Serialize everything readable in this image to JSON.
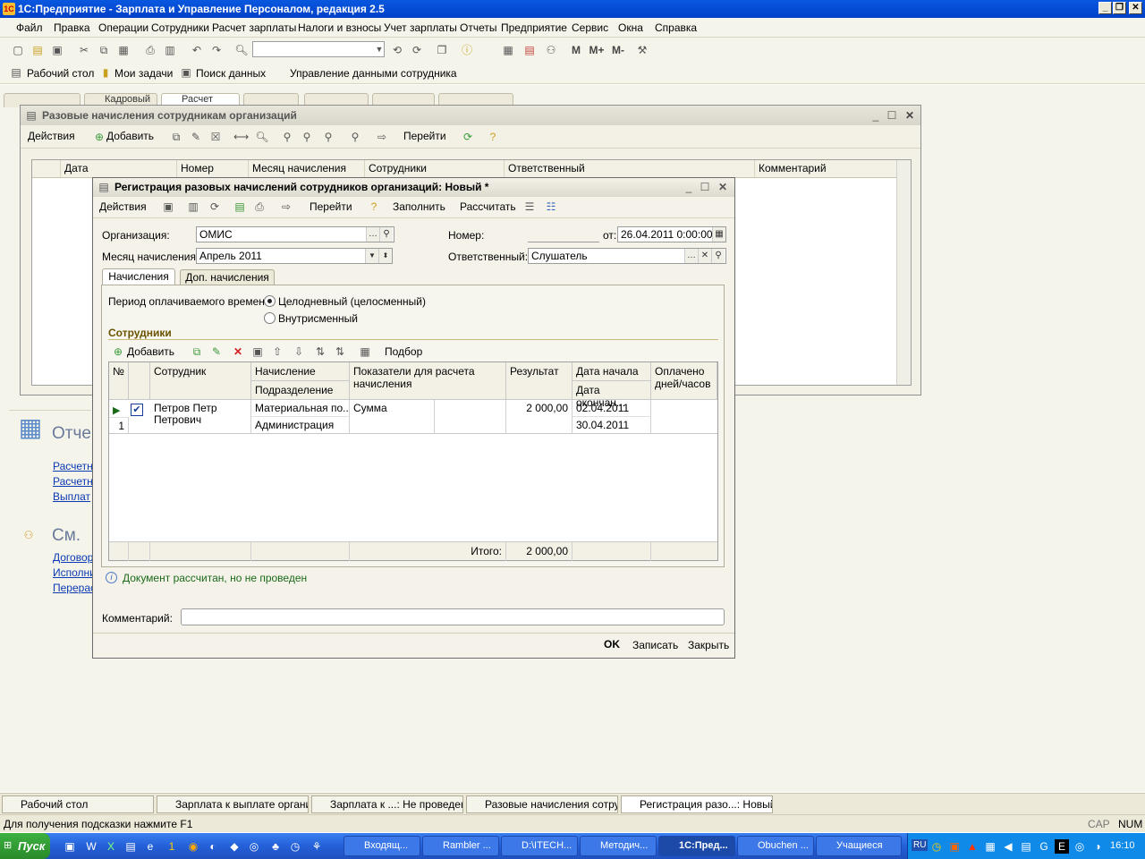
{
  "app": {
    "title": "1С:Предприятие - Зарплата и Управление Персоналом, редакция 2.5"
  },
  "menu": [
    "Файл",
    "Правка",
    "Операции",
    "Сотрудники",
    "Расчет зарплаты",
    "Налоги и взносы",
    "Учет зарплаты",
    "Отчеты",
    "Предприятие",
    "Сервис",
    "Окна",
    "Справка"
  ],
  "toolbar2": {
    "desktop": "Рабочий стол",
    "tasks": "Мои задачи",
    "search": "Поиск данных",
    "manage": "Управление данными сотрудника"
  },
  "bg_tabs": [
    "Кадровый",
    "Расчет"
  ],
  "list_window": {
    "title": "Разовые начисления сотрудникам организаций",
    "actions": "Действия",
    "add": "Добавить",
    "goto": "Перейти",
    "columns": [
      "Дата",
      "Номер",
      "Месяц начисления",
      "Сотрудники",
      "Ответственный",
      "Комментарий"
    ]
  },
  "doc_window": {
    "title": "Регистрация разовых начислений сотрудников организаций: Новый *",
    "actions": "Действия",
    "goto": "Перейти",
    "fill": "Заполнить",
    "calc": "Рассчитать",
    "org_label": "Организация:",
    "org_value": "ОМИС",
    "number_label": "Номер:",
    "number_value": "",
    "from_label": "от:",
    "date_value": "26.04.2011  0:00:00",
    "month_label": "Месяц начисления:",
    "month_value": "Апрель 2011",
    "resp_label": "Ответственный:",
    "resp_value": "Слушатель",
    "tab1": "Начисления",
    "tab2": "Доп. начисления",
    "period_label": "Период оплачиваемого времени:",
    "radio1": "Целодневный (целосменный)",
    "radio2": "Внутрисменный",
    "section": "Сотрудники",
    "grid_add": "Добавить",
    "select": "Подбор",
    "grid_headers": {
      "num": "№",
      "employee": "Сотрудник",
      "accrual": "Начисление",
      "dept": "Подразделение",
      "indicators": "Показатели для расчета начисления",
      "result": "Результат",
      "date_start": "Дата начала",
      "date_end": "Дата окончан...",
      "paid": "Оплачено дней/часов"
    },
    "rows": [
      {
        "num": "1",
        "employee": "Петров Петр Петрович",
        "accrual": "Материальная по...",
        "dept": "Администрация",
        "indicator": "Сумма",
        "result": "2 000,00",
        "date_start": "02.04.2011",
        "date_end": "30.04.2011"
      }
    ],
    "total_label": "Итого:",
    "total_value": "2 000,00",
    "info": "Документ рассчитан, но не проведен",
    "comment_label": "Комментарий:",
    "ok": "OK",
    "save": "Записать",
    "close": "Закрыть"
  },
  "left_panel": {
    "reports_heading": "Отче",
    "reports_links": [
      "Расчетн",
      "Расчетн",
      "Выплат"
    ],
    "see_heading": "См.",
    "see_links": [
      "Договор",
      "Исполни",
      "Перерас"
    ]
  },
  "window_tabs": [
    "Рабочий стол",
    "Зарплата к выплате органи...",
    "Зарплата к ...: Не проведен *",
    "Разовые начисления сотру...",
    "Регистрация разо...: Новый *"
  ],
  "status": {
    "hint": "Для получения подсказки нажмите F1",
    "cap": "CAP",
    "num": "NUM"
  },
  "taskbar": {
    "start": "Пуск",
    "buttons": [
      "Входящ...",
      "Rambler ...",
      "D:\\ITECH...",
      "Методич...",
      "1С:Пред...",
      "Obuchen ...",
      "Учащиеся"
    ],
    "lang": "RU",
    "time": "16:10"
  }
}
